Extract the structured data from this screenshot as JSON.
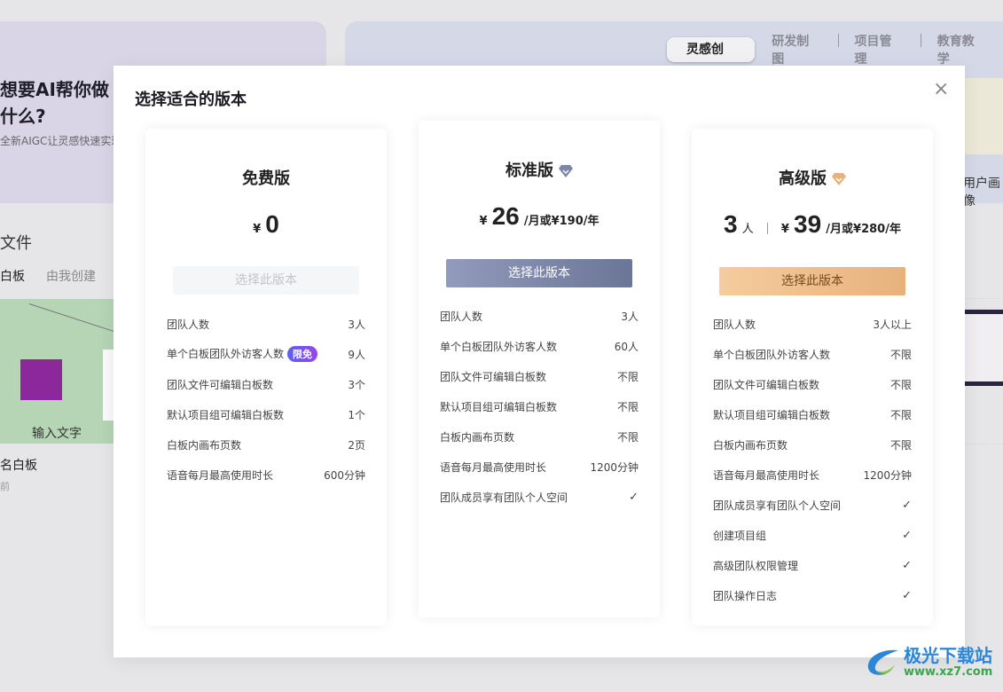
{
  "background": {
    "hero_title": "想要AI帮你做什么?",
    "hero_subtitle": "全新AIGC让灵感快速实现",
    "files_title": "文件",
    "file_tabs": [
      "白板",
      "由我创建"
    ],
    "thumbnail_text": "输入文字",
    "file_name": "名白板",
    "file_time": "前",
    "category_tabs": [
      "灵感创作",
      "研发制图",
      "项目管理",
      "教育教学"
    ],
    "active_category": "灵感创作",
    "right_caption": "用户画像"
  },
  "modal": {
    "title": "选择适合的版本",
    "close_icon": "close-icon",
    "plans": [
      {
        "name": "免费版",
        "currency": "¥",
        "price": "0",
        "button": "选择此版本",
        "button_state": "disabled",
        "features": [
          {
            "label": "团队人数",
            "value": "3人"
          },
          {
            "label": "单个白板团队外访客人数",
            "badge": "限免",
            "value": "9人"
          },
          {
            "label": "团队文件可编辑白板数",
            "value": "3个"
          },
          {
            "label": "默认项目组可编辑白板数",
            "value": "1个"
          },
          {
            "label": "白板内画布页数",
            "value": "2页"
          },
          {
            "label": "语音每月最高使用时长",
            "value": "600分钟"
          }
        ]
      },
      {
        "name": "标准版",
        "icon": "diamond-icon",
        "icon_color": "#7d86a8",
        "currency": "¥",
        "price": "26",
        "unit": "/月或¥190/年",
        "button": "选择此版本",
        "button_color": "#7a84a6",
        "features": [
          {
            "label": "团队人数",
            "value": "3人"
          },
          {
            "label": "单个白板团队外访客人数",
            "value": "60人"
          },
          {
            "label": "团队文件可编辑白板数",
            "value": "不限"
          },
          {
            "label": "默认项目组可编辑白板数",
            "value": "不限"
          },
          {
            "label": "白板内画布页数",
            "value": "不限"
          },
          {
            "label": "语音每月最高使用时长",
            "value": "1200分钟"
          },
          {
            "label": "团队成员享有团队个人空间",
            "value": "✓"
          }
        ]
      },
      {
        "name": "高级版",
        "icon": "diamond-icon",
        "icon_color": "#e6b27a",
        "seats": "3",
        "seats_unit": "人",
        "currency": "¥",
        "price": "39",
        "unit": "/月或¥280/年",
        "button": "选择此版本",
        "button_color": "#ebbb86",
        "features": [
          {
            "label": "团队人数",
            "value": "3人以上"
          },
          {
            "label": "单个白板团队外访客人数",
            "value": "不限"
          },
          {
            "label": "团队文件可编辑白板数",
            "value": "不限"
          },
          {
            "label": "默认项目组可编辑白板数",
            "value": "不限"
          },
          {
            "label": "白板内画布页数",
            "value": "不限"
          },
          {
            "label": "语音每月最高使用时长",
            "value": "1200分钟"
          },
          {
            "label": "团队成员享有团队个人空间",
            "value": "✓"
          },
          {
            "label": "创建项目组",
            "value": "✓"
          },
          {
            "label": "高级团队权限管理",
            "value": "✓"
          },
          {
            "label": "团队操作日志",
            "value": "✓"
          }
        ]
      }
    ]
  },
  "watermark": {
    "name": "极光下载站",
    "url": "www.xz7.com"
  }
}
